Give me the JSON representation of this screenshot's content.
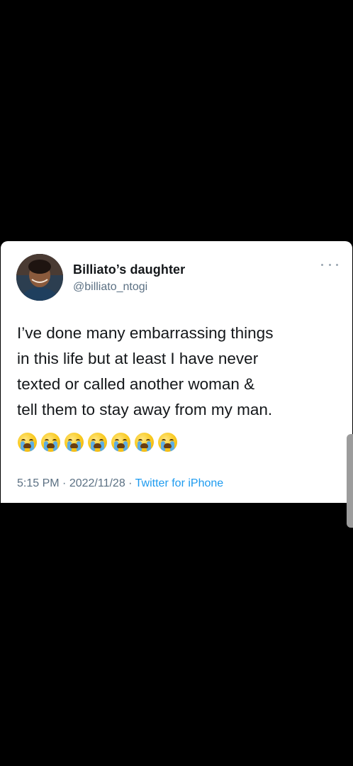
{
  "tweet": {
    "display_name": "Billiato’s daughter",
    "handle": "@billiato_ntogi",
    "text": "I’ve done many embarrassing things\nin this life but at least I have never\ntexted or called another woman &\ntell them to stay away from my man.",
    "emojis": [
      "loudly-crying-face",
      "loudly-crying-face",
      "loudly-crying-face",
      "loudly-crying-face",
      "loudly-crying-face",
      "loudly-crying-face",
      "loudly-crying-face"
    ],
    "time": "5:15 PM",
    "separator": "·",
    "date": "2022/11/28",
    "source": "Twitter for iPhone"
  },
  "colors": {
    "background": "#000000",
    "card": "#ffffff",
    "text": "#14171a",
    "secondary": "#5b7083",
    "link": "#1d9bf0"
  },
  "icons": {
    "more": "more-horizontal-icon",
    "avatar": "avatar"
  }
}
